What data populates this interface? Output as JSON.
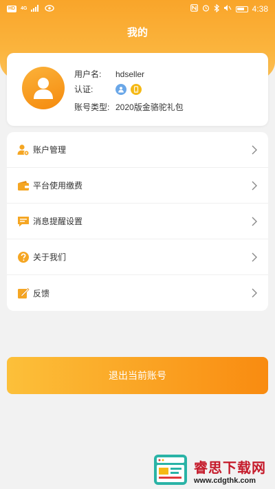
{
  "status_bar": {
    "left_badge_1": "HD",
    "left_badge_2": "4G",
    "time": "4:38"
  },
  "header": {
    "title": "我的"
  },
  "profile": {
    "username_label": "用户名:",
    "username_value": "hdseller",
    "verify_label": "认证:",
    "account_type_label": "账号类型:",
    "account_type_value": "2020版金骆驼礼包",
    "verify_badges": [
      "person-verified-icon",
      "phone-verified-icon"
    ],
    "colors": {
      "badge_person": "#6aa7e8",
      "badge_phone": "#f5b915"
    }
  },
  "menu": {
    "items": [
      {
        "label": "账户管理",
        "icon": "account-settings-icon"
      },
      {
        "label": "平台使用缴费",
        "icon": "wallet-icon"
      },
      {
        "label": "消息提醒设置",
        "icon": "message-icon"
      },
      {
        "label": "关于我们",
        "icon": "question-icon"
      },
      {
        "label": "反馈",
        "icon": "feedback-edit-icon"
      }
    ]
  },
  "logout": {
    "label": "退出当前账号"
  },
  "watermark": {
    "title": "睿思下载网",
    "url": "www.cdgthk.com"
  },
  "colors": {
    "brand_orange": "#f9a52a",
    "brand_orange_dark": "#f98b10",
    "background": "#f2f2f2"
  }
}
